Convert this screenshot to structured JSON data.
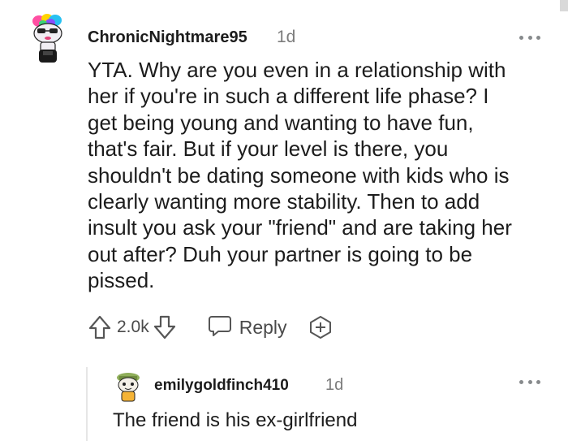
{
  "comment": {
    "username": "ChronicNightmare95",
    "timestamp": "1d",
    "avatar_icon": "snoo-avatar-icon",
    "more_icon": "more-options-icon",
    "body_lines": [
      "YTA. Why are you even in a relationship with",
      "her if you're in such a different life phase? I",
      "get being young and wanting to have fun,",
      "that's fair. But if your level is there, you",
      "shouldn't be dating someone with kids who is",
      "clearly wanting more stability. Then to add",
      "insult you ask your \"friend\" and are taking her",
      "out after? Duh your partner is going to be",
      "pissed."
    ],
    "actions": {
      "upvote_icon": "upvote-arrow-icon",
      "score": "2.0k",
      "downvote_icon": "downvote-arrow-icon",
      "reply_icon": "speech-bubble-icon",
      "reply_label": "Reply",
      "award_icon": "add-award-icon"
    }
  },
  "reply": {
    "username": "emilygoldfinch410",
    "timestamp": "1d",
    "avatar_icon": "snoo-avatar-icon",
    "more_icon": "more-options-icon",
    "body": "The friend is his ex-girlfriend"
  },
  "colors": {
    "text": "#1c1c1c",
    "meta": "#7c7c7c",
    "icon": "#878a8c",
    "thread_line": "#e6e6e6"
  }
}
